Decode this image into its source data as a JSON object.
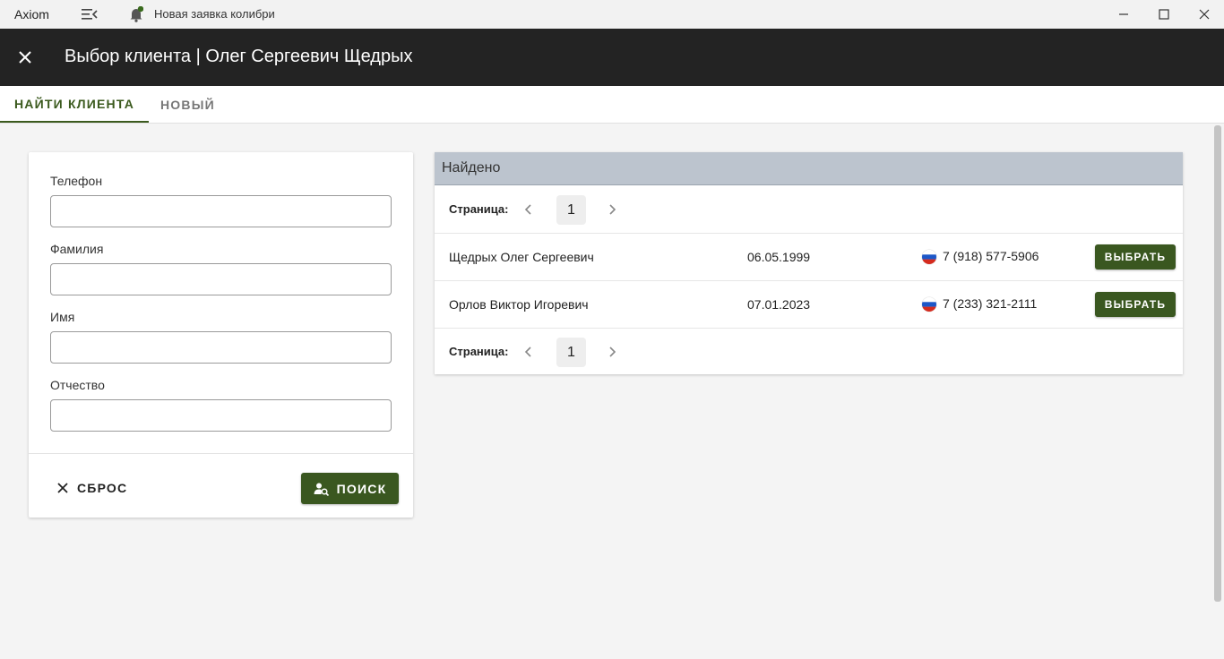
{
  "titlebar": {
    "app_name": "Axiom",
    "notification": "Новая заявка колибри",
    "notification_dot_color": "#3a6b1e"
  },
  "header": {
    "title": "Выбор клиента | Олег Сергеевич Щедрых"
  },
  "tabs": [
    {
      "label": "НАЙТИ КЛИЕНТА",
      "active": true
    },
    {
      "label": "НОВЫЙ",
      "active": false
    }
  ],
  "form": {
    "fields": [
      {
        "label": "Телефон",
        "value": ""
      },
      {
        "label": "Фамилия",
        "value": ""
      },
      {
        "label": "Имя",
        "value": ""
      },
      {
        "label": "Отчество",
        "value": ""
      }
    ],
    "reset_label": "СБРОС",
    "search_label": "ПОИСК"
  },
  "results": {
    "title": "Найдено",
    "pager_label": "Страница:",
    "current_page": "1",
    "rows": [
      {
        "name": "Щедрых Олег Сергеевич",
        "date": "06.05.1999",
        "phone": "7 (918) 577-5906",
        "select_label": "ВЫБРАТЬ"
      },
      {
        "name": "Орлов Виктор Игоревич",
        "date": "07.01.2023",
        "phone": "7 (233) 321-2111",
        "select_label": "ВЫБРАТЬ"
      }
    ]
  },
  "colors": {
    "accent": "#3a5720",
    "header_bg": "#232323",
    "results_header_bg": "#bcc4ce"
  }
}
